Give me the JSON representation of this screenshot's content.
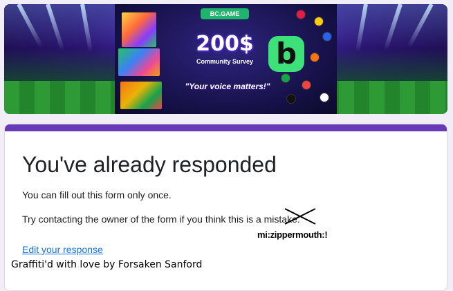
{
  "banner": {
    "brand": "BC.GAME",
    "amount": "200$",
    "headline": "Community Survey",
    "tagline": "\"Your voice matters!\""
  },
  "form": {
    "title": "You've already responded",
    "message_once": "You can fill out this form only once.",
    "message_contact": "Try contacting the owner of the form if you think this is a mistake.",
    "edit_link": "Edit your response",
    "accent_color": "#673ab7",
    "link_color": "#1a73e8"
  },
  "graffiti": {
    "tag": "mi:zippermouth:!",
    "signature": "Graffiti'd with love by Forsaken Sanford"
  }
}
